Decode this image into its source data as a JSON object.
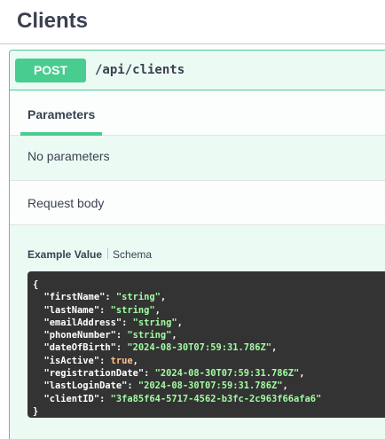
{
  "section": {
    "title": "Clients"
  },
  "operation": {
    "method": "POST",
    "path": "/api/clients"
  },
  "tabs": {
    "parameters_label": "Parameters"
  },
  "parameters": {
    "empty_text": "No parameters"
  },
  "request_body": {
    "label": "Request body"
  },
  "example_tabs": {
    "example_value_label": "Example Value",
    "schema_label": "Schema"
  },
  "example_json": {
    "open_brace": "{",
    "close_brace": "}",
    "fields": [
      {
        "key": "\"firstName\"",
        "value": "\"string\"",
        "type": "string",
        "comma": true
      },
      {
        "key": "\"lastName\"",
        "value": "\"string\"",
        "type": "string",
        "comma": true
      },
      {
        "key": "\"emailAddress\"",
        "value": "\"string\"",
        "type": "string",
        "comma": true
      },
      {
        "key": "\"phoneNumber\"",
        "value": "\"string\"",
        "type": "string",
        "comma": true
      },
      {
        "key": "\"dateOfBirth\"",
        "value": "\"2024-08-30T07:59:31.786Z\"",
        "type": "string",
        "comma": true
      },
      {
        "key": "\"isActive\"",
        "value": "true",
        "type": "boolean",
        "comma": true
      },
      {
        "key": "\"registrationDate\"",
        "value": "\"2024-08-30T07:59:31.786Z\"",
        "type": "string",
        "comma": true
      },
      {
        "key": "\"lastLoginDate\"",
        "value": "\"2024-08-30T07:59:31.786Z\"",
        "type": "string",
        "comma": true
      },
      {
        "key": "\"clientID\"",
        "value": "\"3fa85f64-5717-4562-b3fc-2c963f66afa6\"",
        "type": "string",
        "comma": false
      }
    ]
  },
  "colors": {
    "post_green": "#49cc90",
    "string_value": "#a2fca2",
    "boolean_value": "#fcc28c",
    "code_background": "#333333"
  }
}
